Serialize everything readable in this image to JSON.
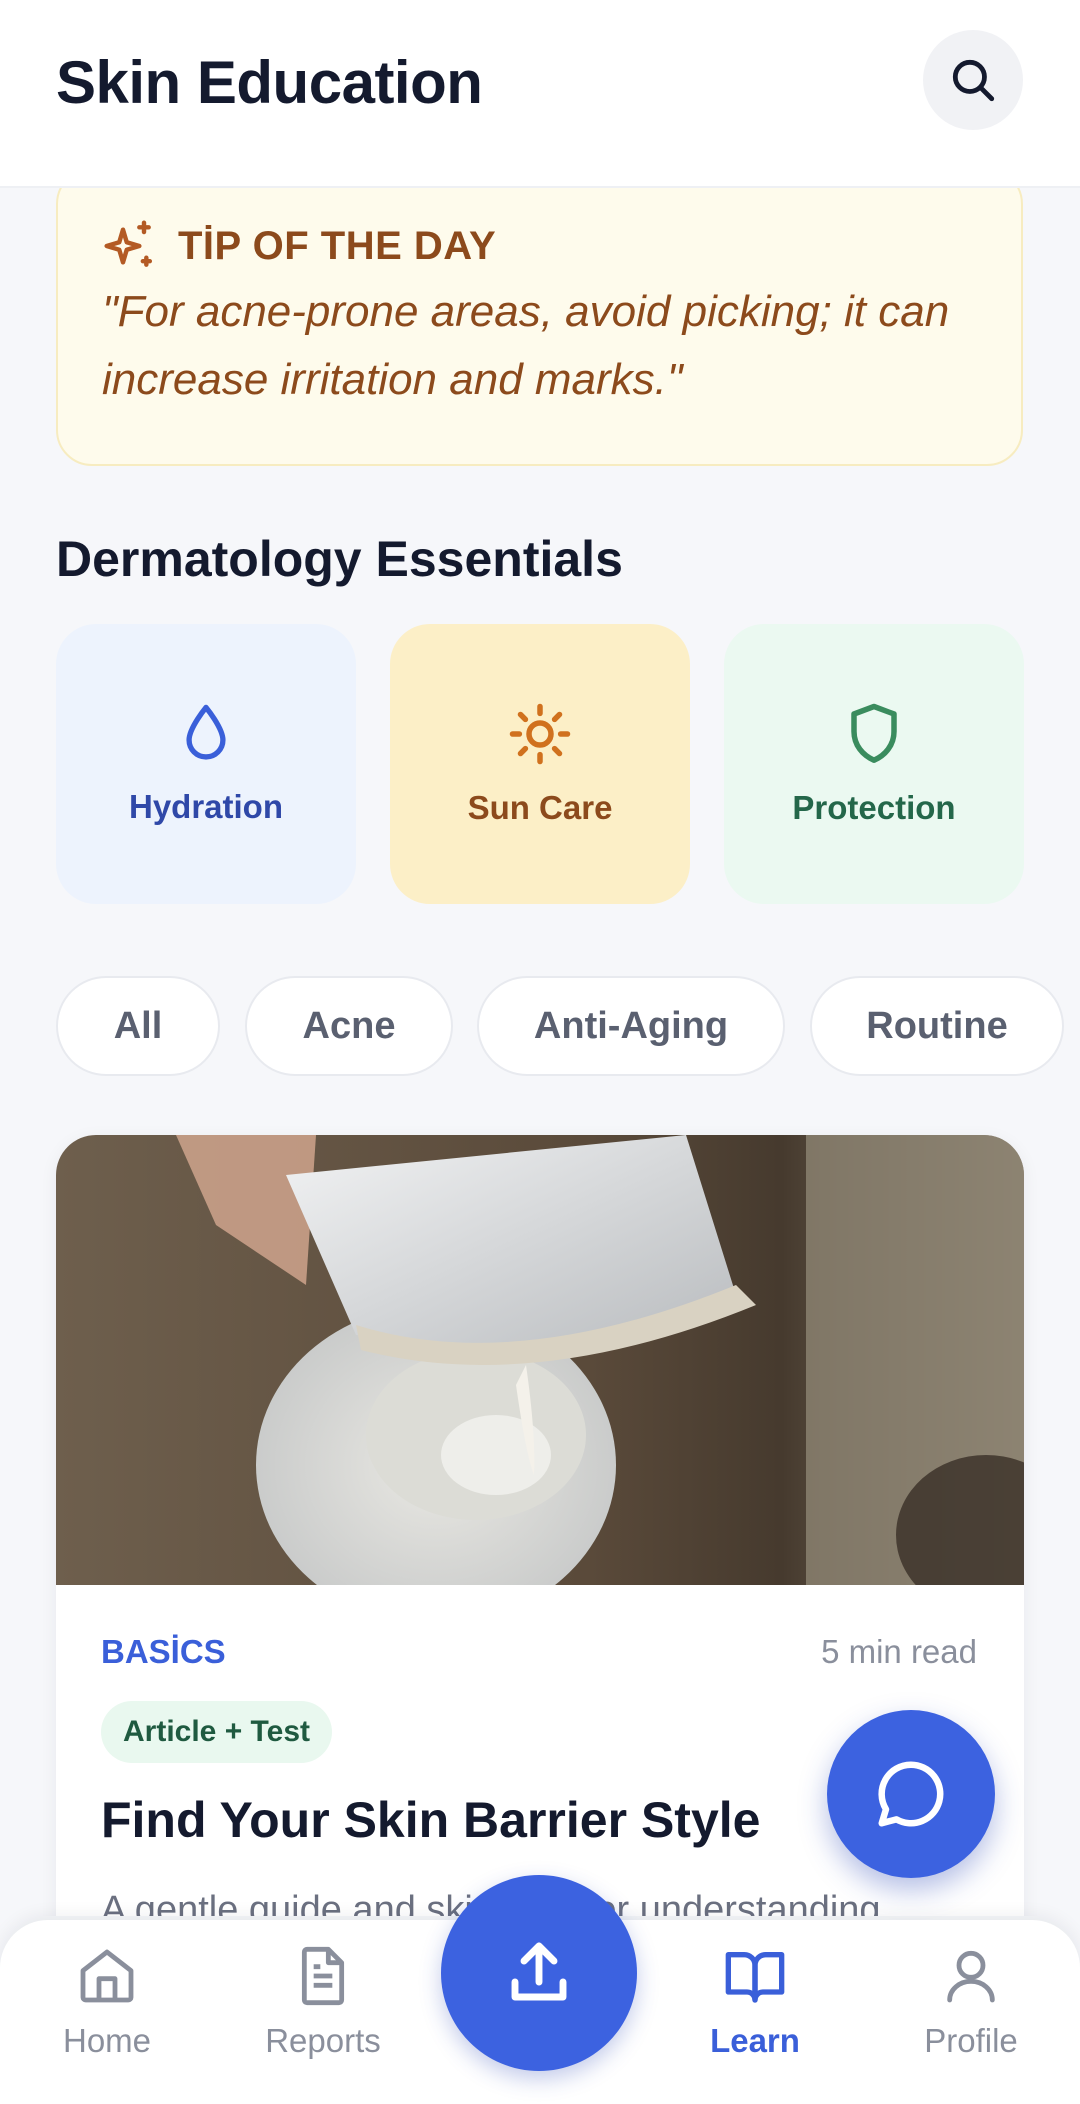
{
  "header": {
    "title": "Skin Education",
    "search_icon": "search-icon"
  },
  "tip": {
    "icon": "sparkles-icon",
    "label": "TİP OF THE DAY",
    "text": "\"For acne-prone areas, avoid picking; it can increase irritation and marks.\""
  },
  "essentials": {
    "title": "Dermatology Essentials",
    "items": [
      {
        "label": "Hydration",
        "icon": "water-drop-icon",
        "color": "#2f48a8",
        "bg": "#edf3fd"
      },
      {
        "label": "Sun Care",
        "icon": "sun-icon",
        "color": "#8c4a1c",
        "bg": "#fcefc7"
      },
      {
        "label": "Protection",
        "icon": "shield-icon",
        "color": "#24674a",
        "bg": "#ebf9f1"
      }
    ]
  },
  "filters": [
    "All",
    "Acne",
    "Anti-Aging",
    "Routine"
  ],
  "article": {
    "category": "BASİCS",
    "read_time": "5 min read",
    "badge": "Article + Test",
    "title": "Find Your Skin Barrier Style",
    "description": "A gentle guide and skin quiz for understanding"
  },
  "nav": {
    "items": [
      {
        "label": "Home",
        "icon": "home-icon"
      },
      {
        "label": "Reports",
        "icon": "document-icon"
      },
      {
        "label": "Learn",
        "icon": "book-open-icon",
        "active": true
      },
      {
        "label": "Profile",
        "icon": "user-icon"
      }
    ],
    "upload_icon": "upload-icon"
  },
  "colors": {
    "accent": "#3c62e0",
    "tip_text": "#8c4a1c",
    "tip_bg": "#fefbec"
  }
}
